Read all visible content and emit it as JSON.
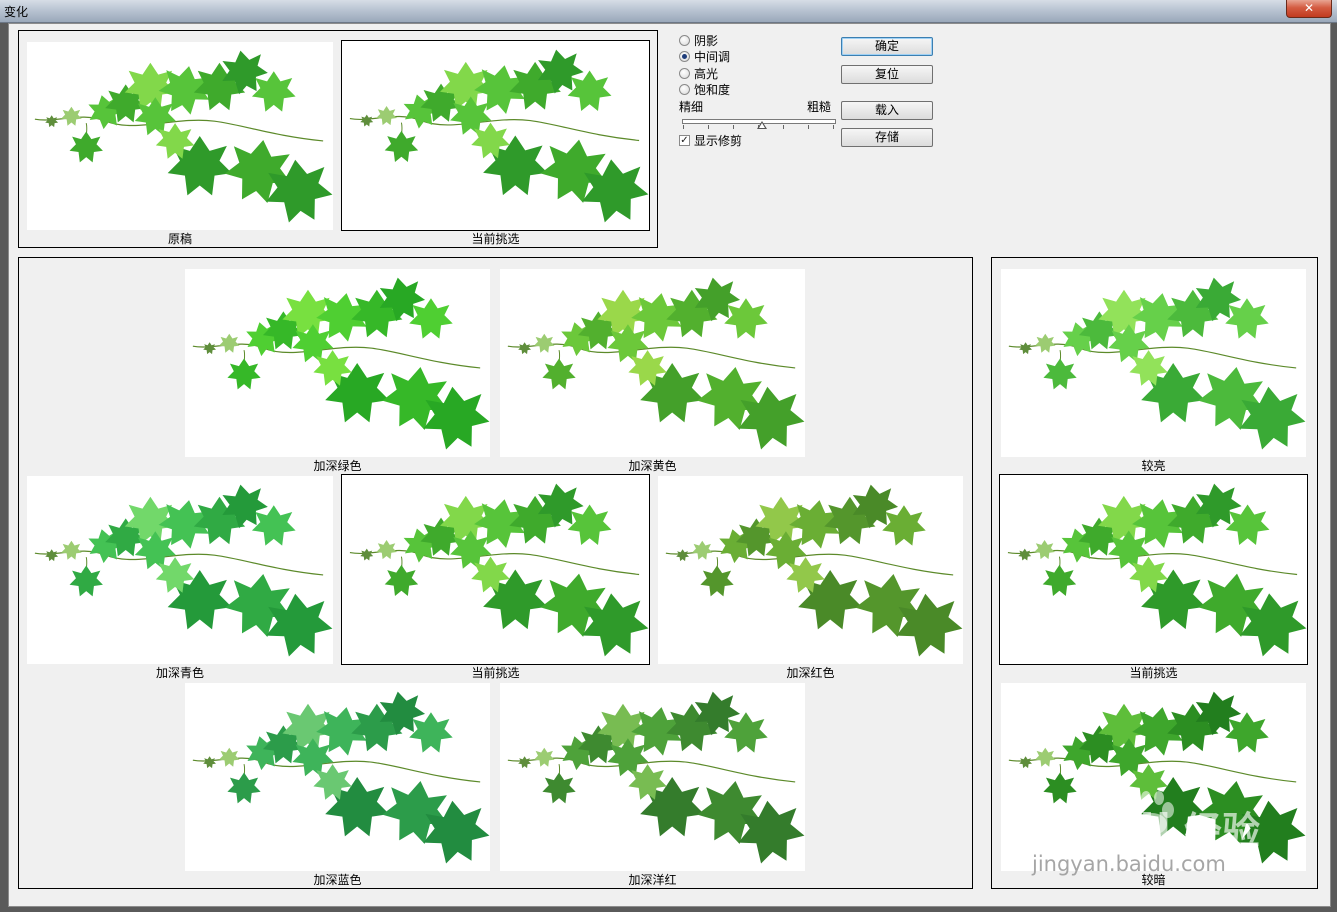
{
  "window": {
    "title": "变化",
    "close_glyph": "✕"
  },
  "top_previews": {
    "original_label": "原稿",
    "current_label": "当前挑选"
  },
  "options": {
    "radios": [
      {
        "label": "阴影",
        "selected": false
      },
      {
        "label": "中间调",
        "selected": true
      },
      {
        "label": "高光",
        "selected": false
      },
      {
        "label": "饱和度",
        "selected": false
      }
    ],
    "slider": {
      "fine_label": "精细",
      "coarse_label": "粗糙",
      "value": 0.5
    },
    "show_clipping": {
      "label": "显示修剪",
      "checked": true,
      "glyph": "✓"
    }
  },
  "buttons": {
    "ok": "确定",
    "reset": "复位",
    "load": "载入",
    "save": "存储"
  },
  "color_variants": {
    "more_green": "加深绿色",
    "more_yellow": "加深黄色",
    "more_cyan": "加深青色",
    "current_pick": "当前挑选",
    "more_red": "加深红色",
    "more_blue": "加深蓝色",
    "more_magenta": "加深洋红"
  },
  "brightness_variants": {
    "lighter": "较亮",
    "current_pick": "当前挑选",
    "darker": "较暗"
  },
  "watermark": {
    "logo": "Baidu",
    "brand": "经验",
    "url": "jingyan.baidu.com"
  },
  "colors": {
    "dialog_bg": "#f0f0f0",
    "thumb_bg": "#ffffff",
    "selection_border": "#000000"
  }
}
